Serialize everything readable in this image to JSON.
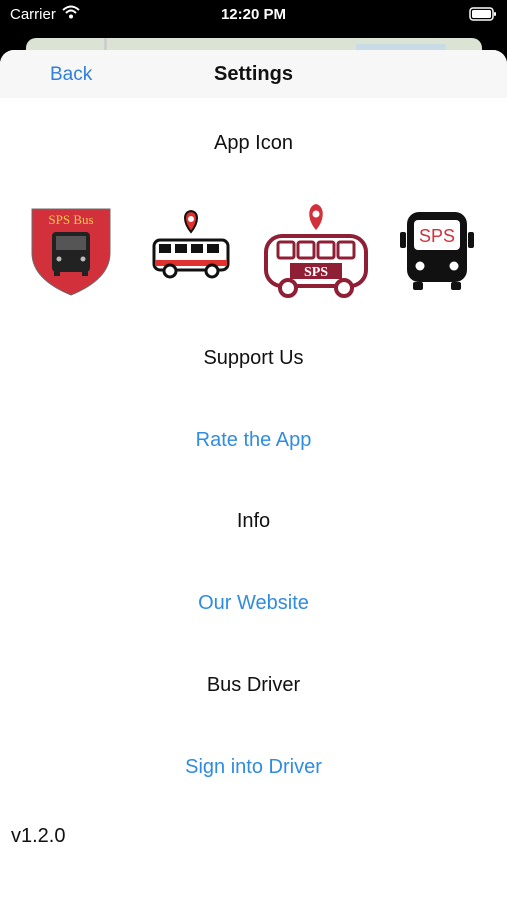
{
  "status_bar": {
    "carrier": "Carrier",
    "time": "12:20 PM"
  },
  "nav": {
    "back_label": "Back",
    "title": "Settings"
  },
  "sections": {
    "app_icon": "App Icon",
    "support_us": "Support Us",
    "rate_app": "Rate the App",
    "info": "Info",
    "our_website": "Our Website",
    "bus_driver": "Bus Driver",
    "sign_into_driver": "Sign into Driver"
  },
  "icons": {
    "shield_text": "SPS Bus",
    "bus_text": "SPS",
    "front_text": "SPS"
  },
  "colors": {
    "accent": "#2f8ce0",
    "brand_red": "#d2303a",
    "maroon": "#8e1f35"
  },
  "version": "v1.2.0"
}
